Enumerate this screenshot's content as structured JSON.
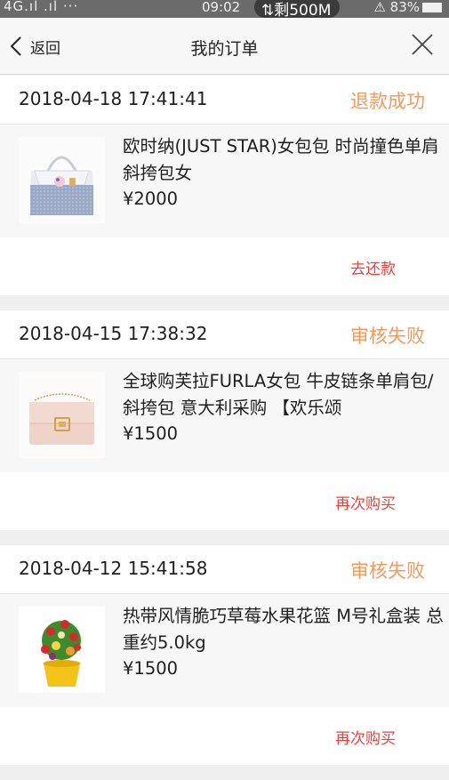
{
  "status_bar": {
    "signal": "4G.ıl .ıl ···",
    "time": "09:02",
    "data_badge": "⇅剩500M",
    "battery": "⚠ 83%"
  },
  "nav": {
    "back_label": "返回",
    "title": "我的订单"
  },
  "orders": [
    {
      "date": "2018-04-18 17:41:41",
      "status": "退款成功",
      "name": "欧时纳(JUST STAR)女包包 时尚撞色单肩斜挎包女",
      "price": "¥2000",
      "action": "去还款",
      "image": "handbag-blue"
    },
    {
      "date": "2018-04-15 17:38:32",
      "status": "审核失败",
      "name": "全球购芙拉FURLA女包 牛皮链条单肩包/斜挎包 意大利采购 【欢乐颂",
      "price": "¥1500",
      "action": "再次购买",
      "image": "handbag-pink"
    },
    {
      "date": "2018-04-12 15:41:58",
      "status": "审核失败",
      "name": "热带风情脆巧草莓水果花篮 M号礼盒装 总重约5.0kg",
      "price": "¥1500",
      "action": "再次购买",
      "image": "fruit-basket"
    }
  ],
  "colors": {
    "status": "#f29a5c",
    "action": "#e8403c",
    "background": "#efefef"
  }
}
